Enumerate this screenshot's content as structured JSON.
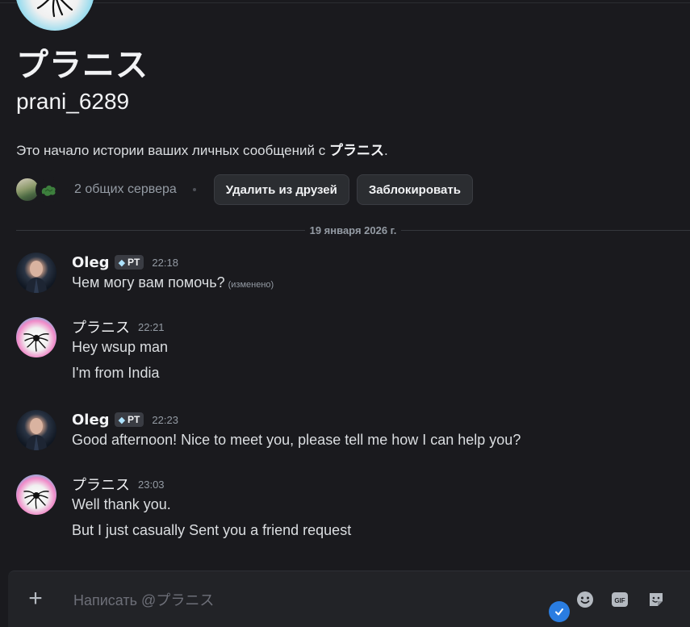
{
  "profile": {
    "display_name": "プラニス",
    "username": "prani_6289",
    "intro_prefix": "Это начало истории ваших личных сообщений с ",
    "intro_name": "プラニス",
    "intro_suffix": ".",
    "mutual_servers": "2 общих сервера",
    "remove_friend_label": "Удалить из друзей",
    "block_label": "Заблокировать"
  },
  "date_divider": "19 января 2026 г.",
  "messages": [
    {
      "author": "Oleg",
      "tag": "PT",
      "time": "22:18",
      "lines": [
        "Чем могу вам помочь?"
      ],
      "edited": "(изменено)"
    },
    {
      "author": "プラニス",
      "time": "22:21",
      "lines": [
        "Hey wsup man",
        "I'm from India"
      ]
    },
    {
      "author": "Oleg",
      "tag": "PT",
      "time": "22:23",
      "lines": [
        "Good afternoon! Nice to meet you, please tell me how I can help you?"
      ]
    },
    {
      "author": "プラニス",
      "time": "23:03",
      "lines": [
        "Well thank you.",
        "But I just casually Sent you a friend request"
      ]
    }
  ],
  "composer": {
    "placeholder": "Написать @プラニス",
    "gif_label": "GIF"
  },
  "icons": {
    "plus": "plus-icon",
    "emoji": "emoji-icon",
    "gif": "gif-icon",
    "sticker": "sticker-icon",
    "gem": "gem-icon",
    "check": "check-badge-icon"
  },
  "colors": {
    "background": "#1a1a1e",
    "button_bg": "#2b2d31",
    "muted_text": "#949ba4",
    "accent_blue": "#2a7de1"
  }
}
